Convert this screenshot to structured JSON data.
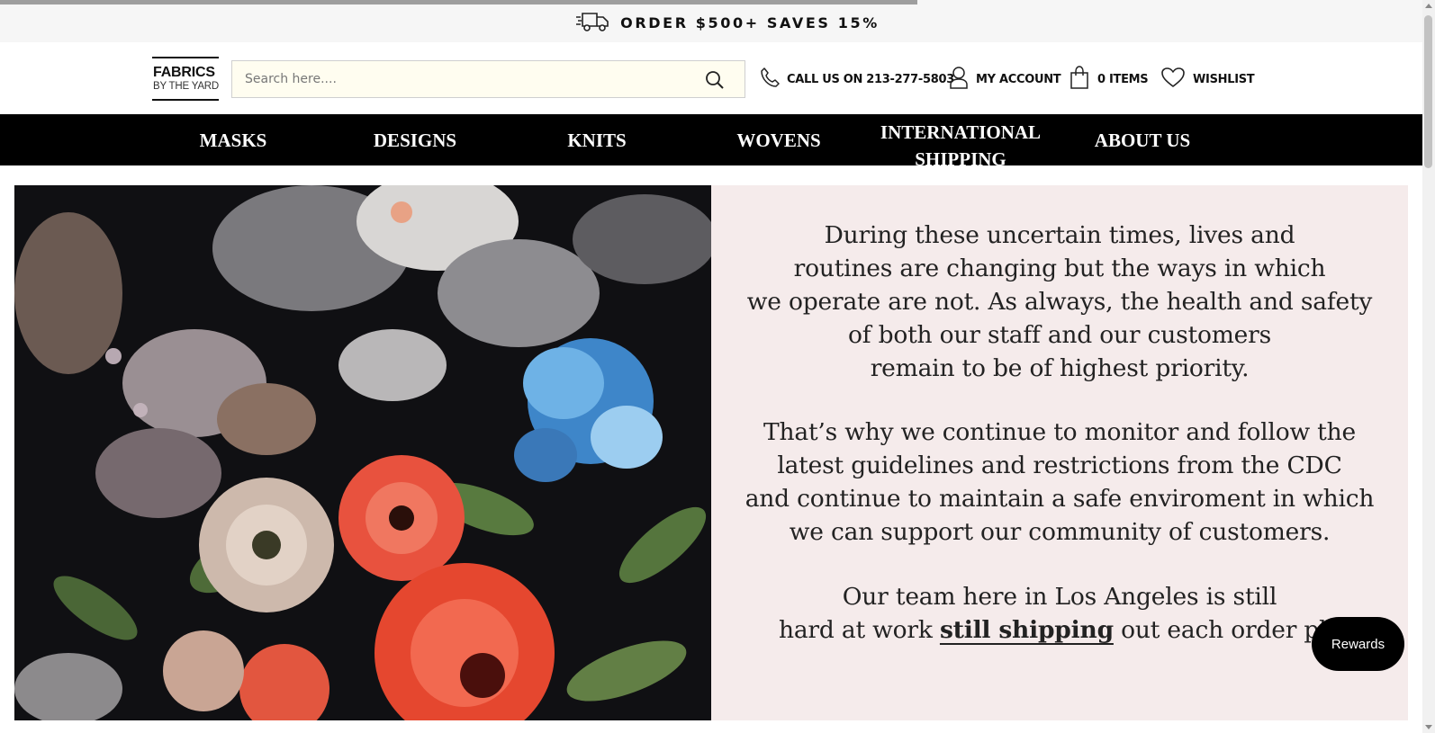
{
  "promo": {
    "icon": "delivery-truck-icon",
    "text": "ORDER $500+ SAVES 15%"
  },
  "logo": {
    "line1": "FABRICS",
    "line2": "BY THE YARD"
  },
  "search": {
    "placeholder": "Search here...."
  },
  "header": {
    "call_label": "CALL US ON 213-277-5803",
    "account_label": "MY ACCOUNT",
    "cart_label": "0 ITEMS",
    "wishlist_label": "WISHLIST"
  },
  "nav": {
    "items": [
      "MASKS",
      "DESIGNS",
      "KNITS",
      "WOVENS",
      "INTERNATIONAL SHIPPING",
      "ABOUT US"
    ]
  },
  "hero": {
    "paragraph1": "During these uncertain times, lives and\nroutines are changing but the ways in which\nwe operate are not. As always, the health and safety\nof both our staff and our customers\nremain to be of highest priority.",
    "paragraph2": "That’s why we continue to monitor and follow the\nlatest guidelines and restrictions from the CDC\nand continue to maintain a safe enviroment in which\nwe can support our community of customers.",
    "paragraph3_line1": "Our team here in Los Angeles is still",
    "paragraph3_pre": "hard at work ",
    "paragraph3_link": "still shipping",
    "paragraph3_post": " out each order pla"
  },
  "rewards": {
    "label": "Rewards"
  },
  "colors": {
    "nav_bg": "#000000",
    "promo_bg": "#f6f6f6",
    "hero_text_bg": "#f5ebeb",
    "search_bg": "#fffdf0"
  }
}
